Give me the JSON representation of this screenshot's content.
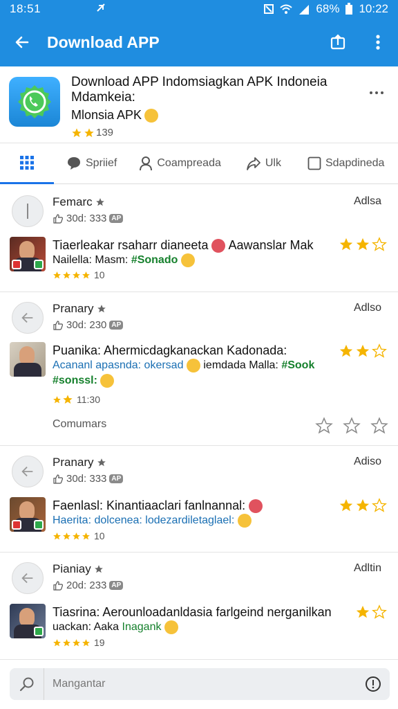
{
  "status_bar": {
    "time": "18:51",
    "battery_text": "68%",
    "clock_right": "10:22"
  },
  "app_bar": {
    "title": "Download APP"
  },
  "app": {
    "name": "Download APP Indomsiagkan APK Indoneia Mdamkeia:",
    "subtitle": "Mlonsia APK",
    "rating_count": "139"
  },
  "tabs": [
    {
      "label": ""
    },
    {
      "label": "Spriief"
    },
    {
      "label": "Coampreada"
    },
    {
      "label": "Ulk"
    },
    {
      "label": "Sdapdineda"
    }
  ],
  "reviews": [
    {
      "name": "Femarc",
      "meta": "30d: 333",
      "badge": "AP",
      "action": "Adlsa",
      "text1": "Tiaerleakar rsaharr dianeeta",
      "text1b": "Aawanslar Mak",
      "text2a": "Nailella: Masm:",
      "text2_hashtag": "#Sonado",
      "rating_small": "10"
    },
    {
      "name": "Pranary",
      "meta": "30d: 230",
      "badge": "AP",
      "action": "Adlso",
      "text1": "Puanika: Ahermicdagkanackan Kadonada:",
      "text2_link": "Acananl apasnda: okersad",
      "text2b": "iemdada Malla:",
      "text2_hashtag": "#Sook",
      "text3_hashtag": "#sonssl:",
      "rating_small": "11:30",
      "comments_label": "Comumars"
    },
    {
      "name": "Pranary",
      "meta": "30d: 333",
      "badge": "AP",
      "action": "Adiso",
      "text1": "Faenlasl: Kinantiaaclari fanlnannal:",
      "text2_link": "Haerita: dolcenea: lodezardiletaglael:",
      "rating_small": "10"
    },
    {
      "name": "Pianiay",
      "meta": "20d: 233",
      "badge": "AP",
      "action": "Adltin",
      "text1": "Tiasrina: Aerounloadanldasia farlgeind nerganilkan",
      "text2a": "uackan: Aaka",
      "text2_hashtag": "Inagank",
      "rating_small": "19"
    }
  ],
  "search": {
    "placeholder": "Mangantar"
  },
  "colors": {
    "primary": "#1f8de0",
    "star": "#f5b400",
    "hashtag": "#15802c",
    "link": "#1a6fb3"
  },
  "icons": [
    "back-arrow-icon",
    "share-icon",
    "more-vert-icon",
    "grid-icon",
    "chat-bubble-icon",
    "person-icon",
    "share-arrow-icon",
    "checkbox-icon",
    "star-icon",
    "thumb-up-icon",
    "search-icon",
    "alert-icon"
  ]
}
